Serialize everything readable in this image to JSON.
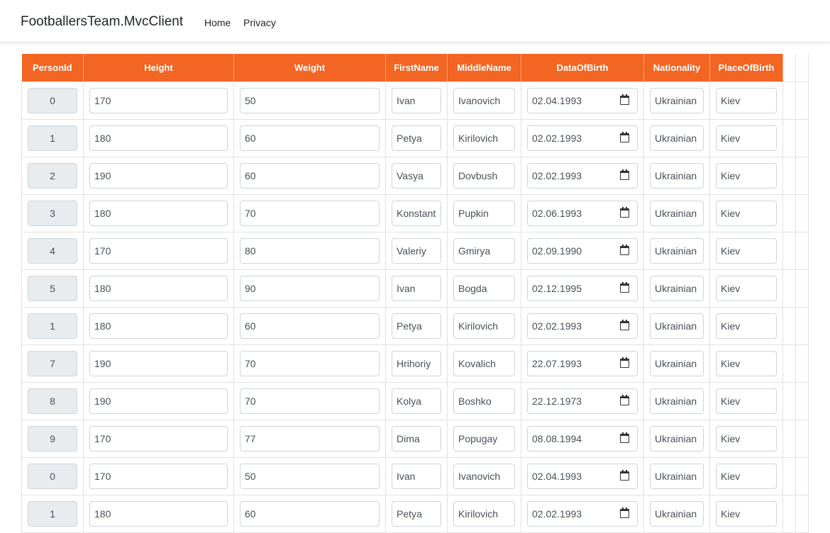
{
  "navbar": {
    "brand": "FootballersTeam.MvcClient",
    "links": [
      "Home",
      "Privacy"
    ]
  },
  "table": {
    "headers": [
      "PersonId",
      "Height",
      "Weight",
      "FirstName",
      "MiddleName",
      "DataOfBirth",
      "Nationality",
      "PlaceOfBirth"
    ],
    "rows": [
      [
        "0",
        "170",
        "50",
        "Ivan",
        "Ivanovich",
        "02.04.1993",
        "Ukrainian",
        "Kiev"
      ],
      [
        "1",
        "180",
        "60",
        "Petya",
        "Kirilovich",
        "02.02.1993",
        "Ukrainian",
        "Kiev"
      ],
      [
        "2",
        "190",
        "60",
        "Vasya",
        "Dovbush",
        "02.02.1993",
        "Ukrainian",
        "Kiev"
      ],
      [
        "3",
        "180",
        "70",
        "Konstant",
        "Pupkin",
        "02.06.1993",
        "Ukrainian",
        "Kiev"
      ],
      [
        "4",
        "170",
        "80",
        "Valeriy",
        "Gmirya",
        "02.09.1990",
        "Ukrainian",
        "Kiev"
      ],
      [
        "5",
        "180",
        "90",
        "Ivan",
        "Bogda",
        "02.12.1995",
        "Ukrainian",
        "Kiev"
      ],
      [
        "1",
        "180",
        "60",
        "Petya",
        "Kirilovich",
        "02.02.1993",
        "Ukrainian",
        "Kiev"
      ],
      [
        "7",
        "190",
        "70",
        "Hrihoriy",
        "Kovalich",
        "22.07.1993",
        "Ukrainian",
        "Kiev"
      ],
      [
        "8",
        "190",
        "70",
        "Kolya",
        "Boshko",
        "22.12.1973",
        "Ukrainian",
        "Kiev"
      ],
      [
        "9",
        "170",
        "77",
        "Dima",
        "Popugay",
        "08.08.1994",
        "Ukrainian",
        "Kiev"
      ],
      [
        "0",
        "170",
        "50",
        "Ivan",
        "Ivanovich",
        "02.04.1993",
        "Ukrainian",
        "Kiev"
      ],
      [
        "1",
        "180",
        "60",
        "Petya",
        "Kirilovich",
        "02.02.1993",
        "Ukrainian",
        "Kiev"
      ]
    ]
  },
  "colors": {
    "header_bg": "#f26522",
    "header_text": "#ffffff",
    "readonly_bg": "#e9ecef"
  },
  "icons": {
    "date_picker": "calendar-icon"
  }
}
